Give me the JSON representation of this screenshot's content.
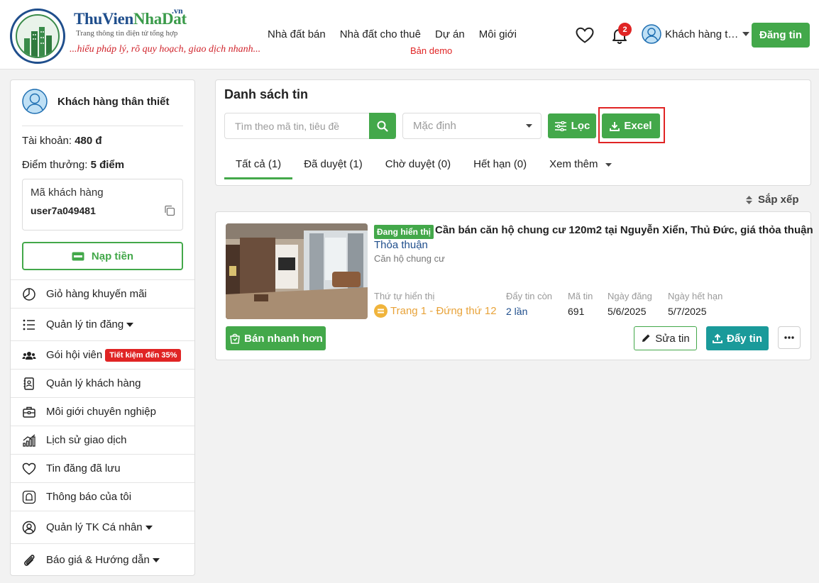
{
  "header": {
    "brand_part1": "ThuVien",
    "brand_part2": "NhaDat",
    "brand_tld": ".vn",
    "brand_subtitle": "Trang thông tin điện tử tổng hợp",
    "brand_slogan": "...hiểu pháp lý, rõ quy hoạch, giao dịch nhanh...",
    "nav": [
      "Nhà đất bán",
      "Nhà đất cho thuê",
      "Dự án",
      "Môi giới"
    ],
    "demo_label": "Bản demo",
    "notification_count": "2",
    "user_name": "Khách hàng thân thiết",
    "post_button": "Đăng tin",
    "colors": {
      "green": "#43a84a",
      "blue": "#1f4e8c",
      "red": "#e02424",
      "teal": "#1a9a9a"
    }
  },
  "sidebar": {
    "user_name": "Khách hàng thân thiết",
    "account_label": "Tài khoản:",
    "account_value": "480 đ",
    "points_label": "Điểm thưởng:",
    "points_value": "5 điểm",
    "customer_code_label": "Mã khách hàng",
    "customer_code": "user7a049481",
    "topup_button": "Nạp tiền",
    "menu": [
      {
        "label": "Giỏ hàng khuyến mãi",
        "icon": "pie-chart-icon"
      },
      {
        "label": "Quản lý tin đăng",
        "icon": "list-icon"
      },
      {
        "label": "Gói hội viên",
        "icon": "members-icon",
        "badge": "Tiết kiệm đến 35%"
      },
      {
        "label": "Quản lý khách hàng",
        "icon": "contact-book-icon"
      },
      {
        "label": "Môi giới chuyên nghiệp",
        "icon": "briefcase-icon"
      },
      {
        "label": "Lịch sử giao dịch",
        "icon": "chart-growth-icon"
      },
      {
        "label": "Tin đăng đã lưu",
        "icon": "heart-icon"
      },
      {
        "label": "Thông báo của tôi",
        "icon": "bell-icon"
      },
      {
        "label": "Quản lý TK Cá nhân",
        "icon": "user-circle-icon"
      },
      {
        "label": "Báo giá & Hướng dẫn",
        "icon": "paperclip-icon"
      }
    ]
  },
  "main": {
    "title": "Danh sách tin",
    "search_placeholder": "Tìm theo mã tin, tiêu đề",
    "sort_select": "Mặc định",
    "filter_button": "Lọc",
    "excel_button": "Excel",
    "tabs": [
      "Tất cả (1)",
      "Đã duyệt (1)",
      "Chờ duyệt (0)",
      "Hết hạn (0)",
      "Xem thêm"
    ],
    "active_tab": 0,
    "sort_label": "Sắp xếp"
  },
  "listing": {
    "status": "Đang hiển thị",
    "title": "Cần bán căn hộ chung cư 120m2 tại Nguyễn Xiển, Thủ Đức, giá thỏa thuận",
    "price": "Thỏa thuận",
    "type": "Căn hộ chung cư",
    "meta": {
      "order_label": "Thứ tự hiển thị",
      "order_value": "Trang 1 - Đứng thứ 12",
      "push_label": "Đẩy tin còn",
      "push_value": "2 lần",
      "id_label": "Mã tin",
      "id_value": "691",
      "posted_label": "Ngày đăng",
      "posted_value": "5/6/2025",
      "expire_label": "Ngày hết hạn",
      "expire_value": "5/7/2025"
    },
    "sell_fast_button": "Bán nhanh hơn",
    "edit_button": "Sửa tin",
    "push_button": "Đẩy tin"
  }
}
